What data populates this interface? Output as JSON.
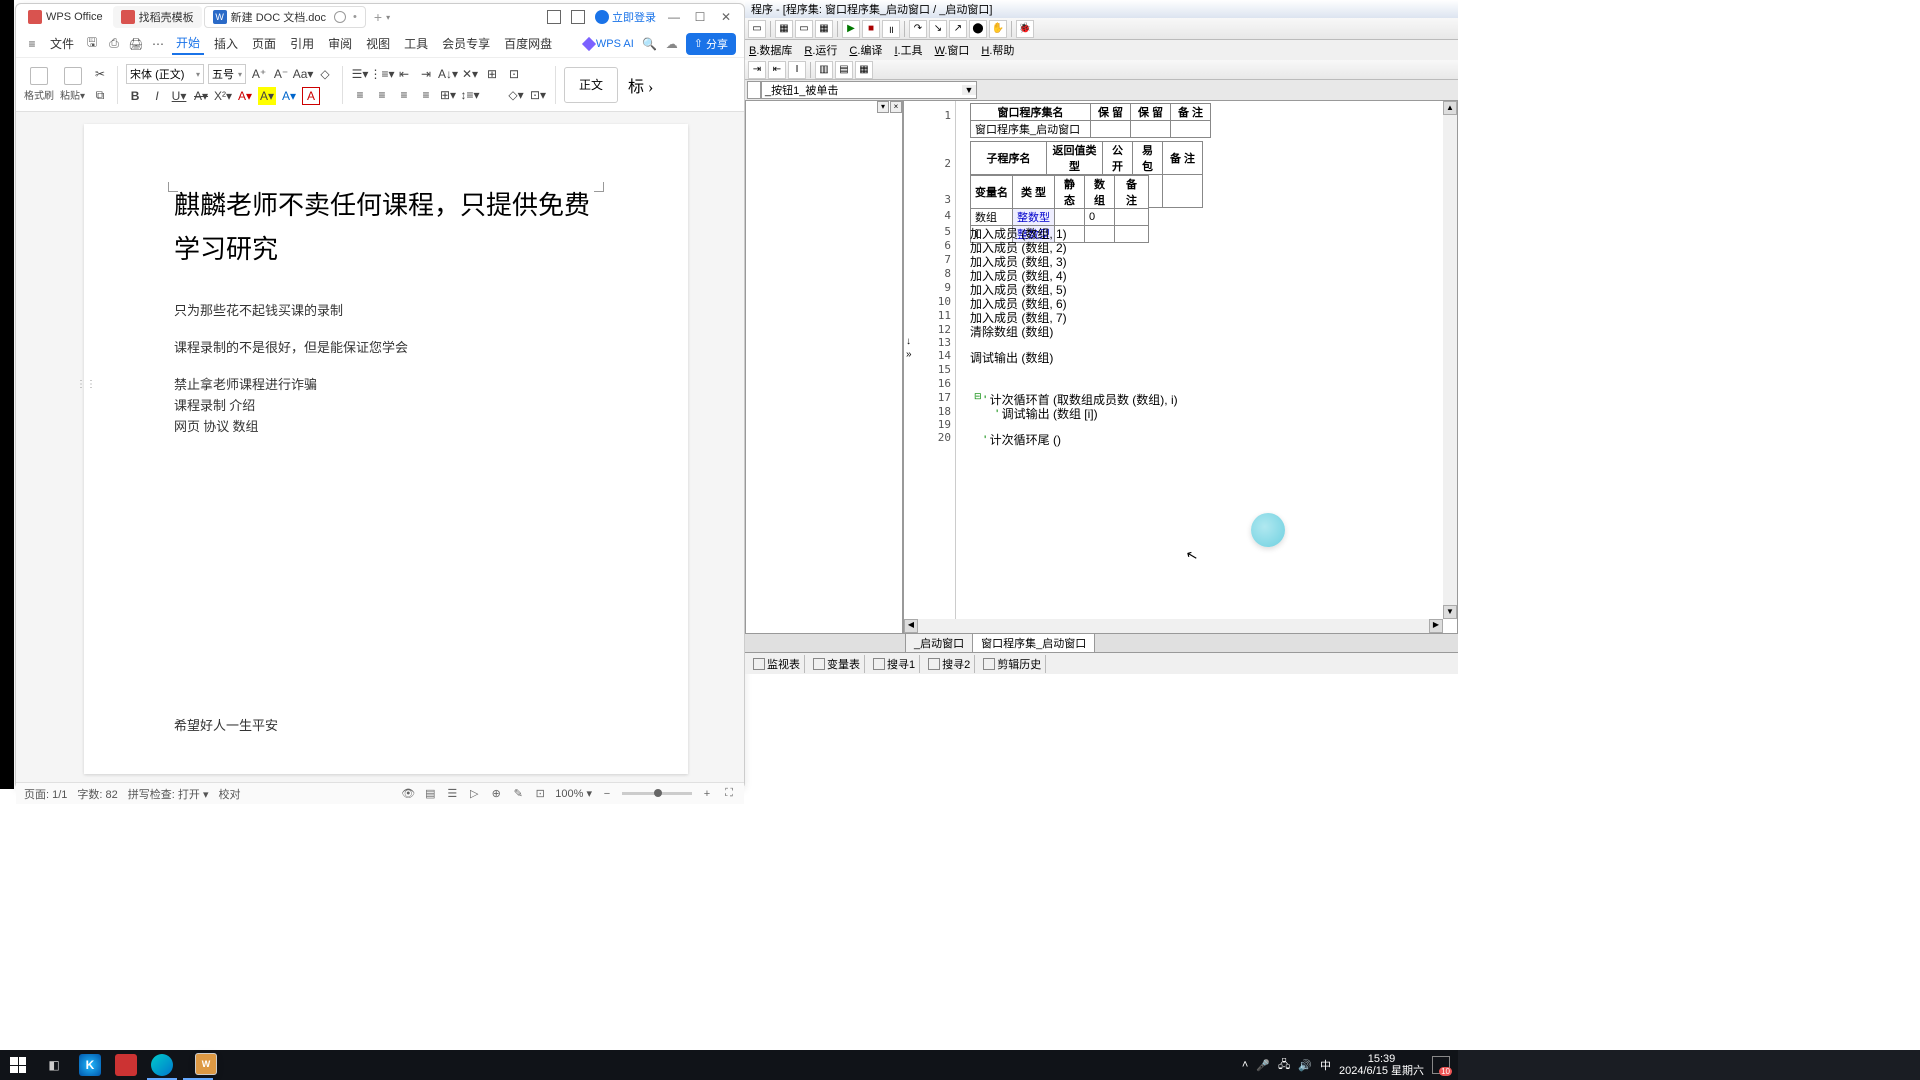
{
  "wps": {
    "home_tab": "WPS Office",
    "find_tab": "找稻壳模板",
    "doc_tab": "新建 DOC 文档.doc",
    "login": "立即登录",
    "file_menu": "文件",
    "menus": [
      "开始",
      "插入",
      "页面",
      "引用",
      "审阅",
      "视图",
      "工具",
      "会员专享",
      "百度网盘"
    ],
    "ai": "WPS AI",
    "share": "分享",
    "format_brush": "格式刷",
    "paste": "粘贴",
    "font": "宋体 (正文)",
    "size": "五号",
    "style_text": "正文",
    "style_label": "标",
    "doc_title": "麒麟老师不卖任何课程，只提供免费学习研究",
    "p1": "只为那些花不起钱买课的录制",
    "p2": "课程录制的不是很好，但是能保证您学会",
    "p3": "禁止拿老师课程进行诈骗",
    "p4": "课程录制  介绍",
    "p5": "网页 协议 数组",
    "p6": "希望好人一生平安",
    "status_page": "页面: 1/1",
    "status_words": "字数: 82",
    "status_spell": "拼写检查: 打开",
    "status_proof": "校对",
    "zoom": "100%"
  },
  "ide": {
    "title": "程序 - [程序集: 窗口程序集_启动窗口 / _启动窗口]",
    "menus": {
      "db": "数据库",
      "run": "运行",
      "compile": "编译",
      "tool": "工具",
      "win": "窗口",
      "help": "帮助"
    },
    "menu_u": {
      "db": "B",
      "run": "R",
      "compile": "C",
      "tool": "I",
      "win": "W",
      "help": "H"
    },
    "combo": "_按钮1_被单击",
    "tbl1_h": [
      "窗口程序集名",
      "保  留",
      "保  留",
      "备  注"
    ],
    "tbl1_r": "窗口程序集_启动窗口",
    "tbl2_h": [
      "子程序名",
      "返回值类型",
      "公开",
      "易包",
      "备  注"
    ],
    "tbl2_r": "_按钮1_被单击",
    "tbl3_h": [
      "变量名",
      "类  型",
      "静态",
      "数组",
      "备  注"
    ],
    "tbl3_rows": [
      {
        "n": "数组",
        "t": "整数型",
        "s": "",
        "a": "0",
        "b": ""
      },
      {
        "n": "i",
        "t": "整数型",
        "s": "",
        "a": "",
        "b": ""
      }
    ],
    "code": {
      "5": "加入成员 (数组, 1)",
      "6": "加入成员 (数组, 2)",
      "7": "加入成员 (数组, 3)",
      "8": "加入成员 (数组, 4)",
      "9": "加入成员 (数组, 5)",
      "10": "加入成员 (数组, 6)",
      "11": "加入成员 (数组, 7)",
      "12": "清除数组 (数组)",
      "14": "调试输出 (数组)",
      "17": "计次循环首 (取数组成员数 (数组), i)",
      "18": "调试输出 (数组 [i])",
      "20": "计次循环尾 ()"
    },
    "tabs": [
      "_启动窗口",
      "窗口程序集_启动窗口"
    ],
    "bottom": [
      "监视表",
      "变量表",
      "搜寻1",
      "搜寻2",
      "剪辑历史"
    ]
  },
  "tray": {
    "ime": "中",
    "time": "15:39",
    "date": "2024/6/15 星期六",
    "notif": "10"
  }
}
